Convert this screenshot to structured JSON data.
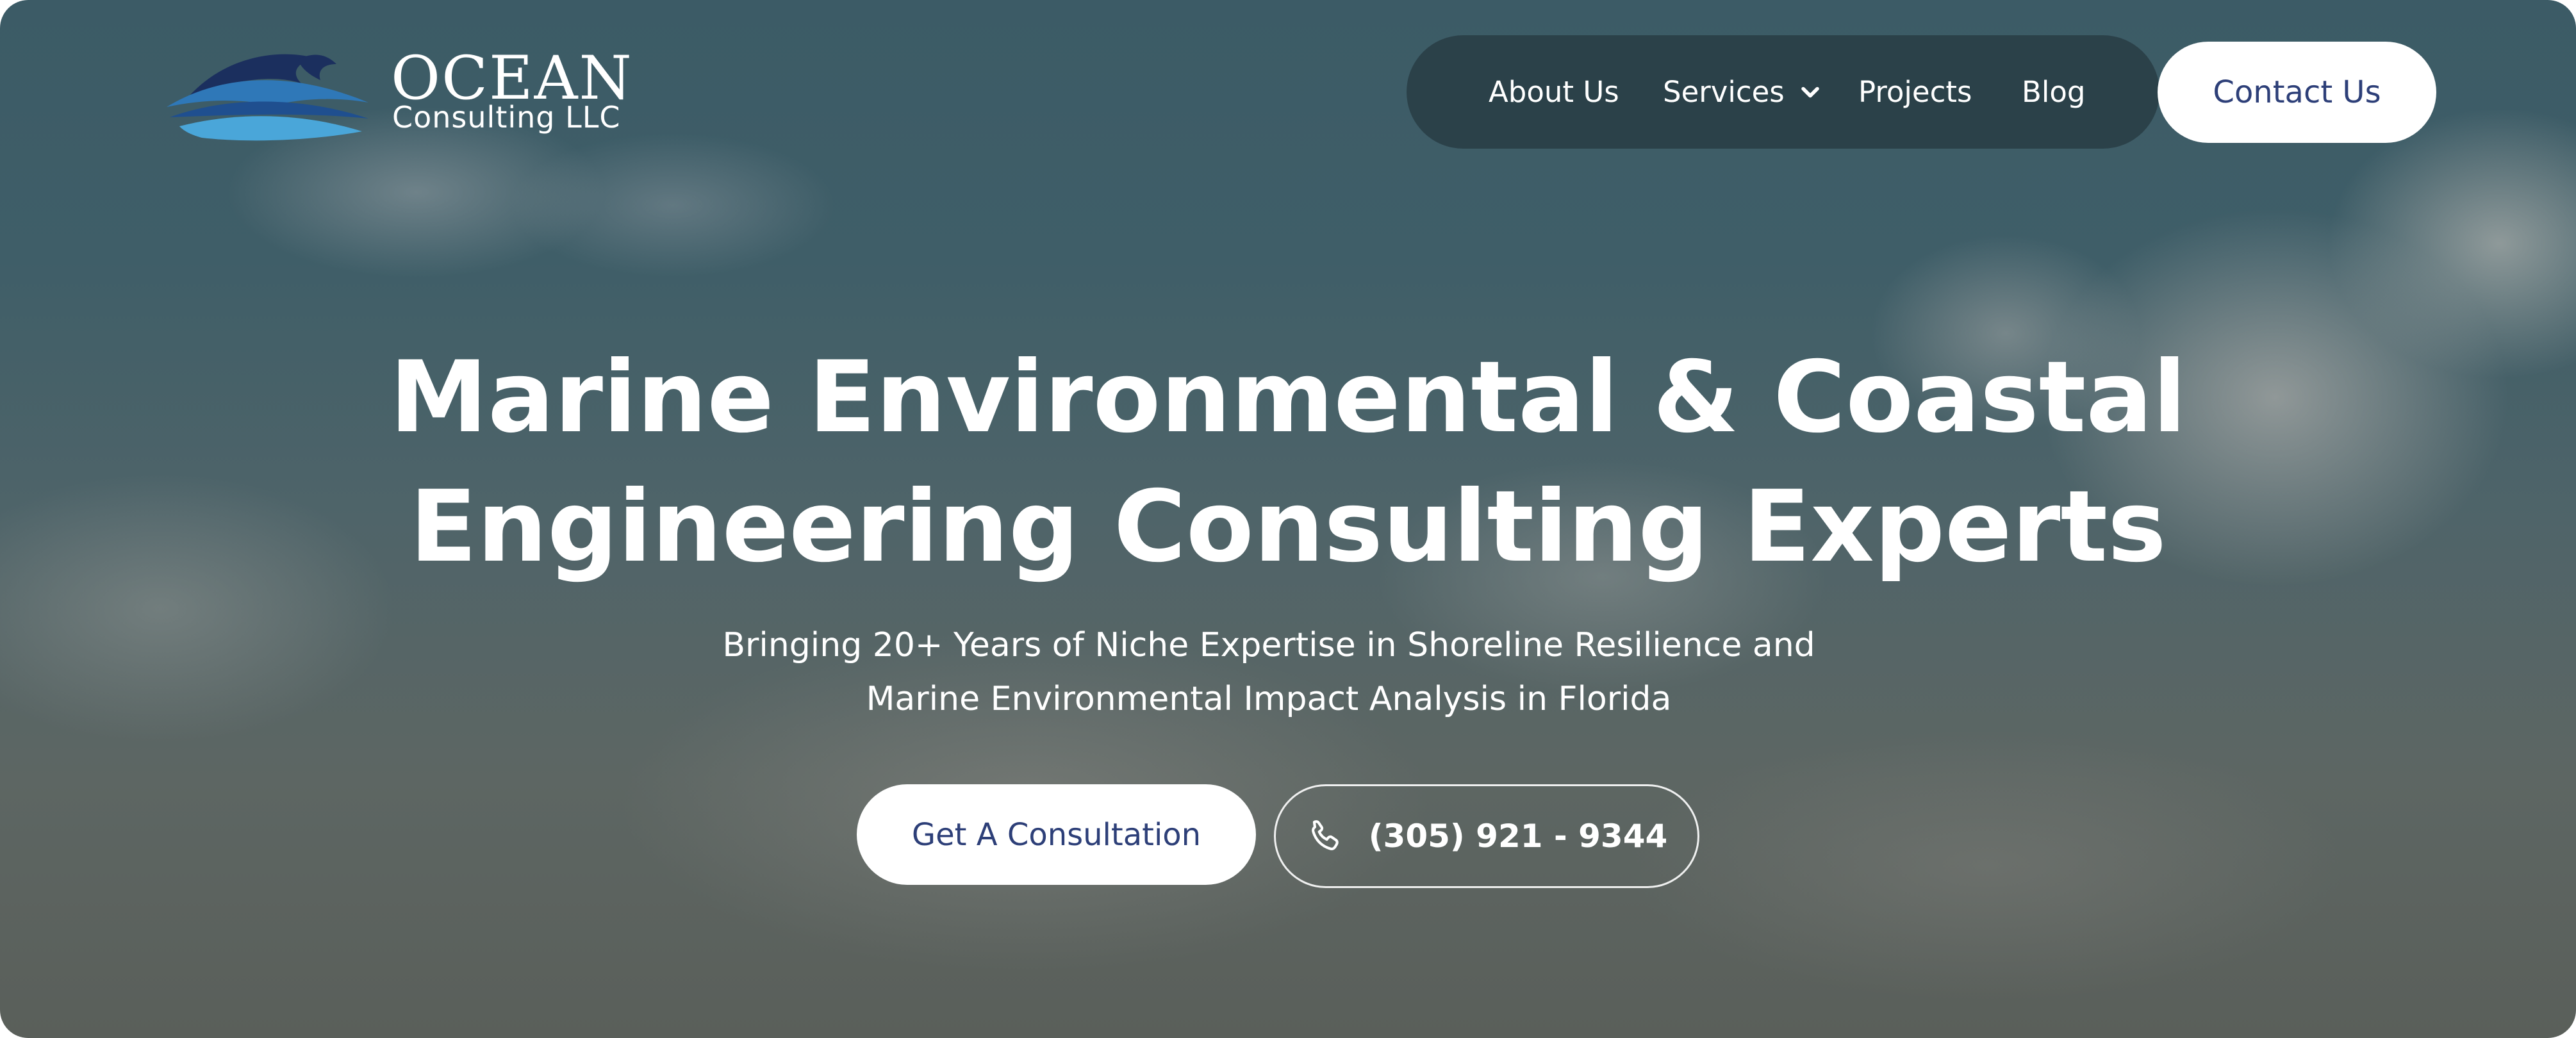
{
  "brand": {
    "name": "OCEAN",
    "tagline": "Consulting LLC",
    "logo_icon": "wave-logo-icon",
    "colors": {
      "wave_dark": "#1f4f8f",
      "wave_mid": "#2f78b8",
      "wave_light": "#4aa6d9",
      "wave_accent": "#1b2f5e"
    }
  },
  "nav": {
    "items": [
      {
        "label": "About Us"
      },
      {
        "label": "Services",
        "icon": "chevron-down-icon"
      },
      {
        "label": "Projects"
      },
      {
        "label": "Blog"
      }
    ],
    "contact_label": "Contact Us"
  },
  "hero": {
    "headline_line1": "Marine Environmental & Coastal",
    "headline_line2": "Engineering Consulting Experts",
    "subhead_line1": "Bringing 20+ Years of Niche Expertise in Shoreline Resilience and",
    "subhead_line2": "Marine Environmental Impact Analysis in Florida",
    "cta_primary_label": "Get A Consultation",
    "cta_phone_label": "(305) 921 - 9344",
    "cta_phone_icon": "phone-icon"
  },
  "theme": {
    "nav_bg": "#2b4149",
    "button_text": "#2d3f78",
    "text": "#ffffff"
  }
}
